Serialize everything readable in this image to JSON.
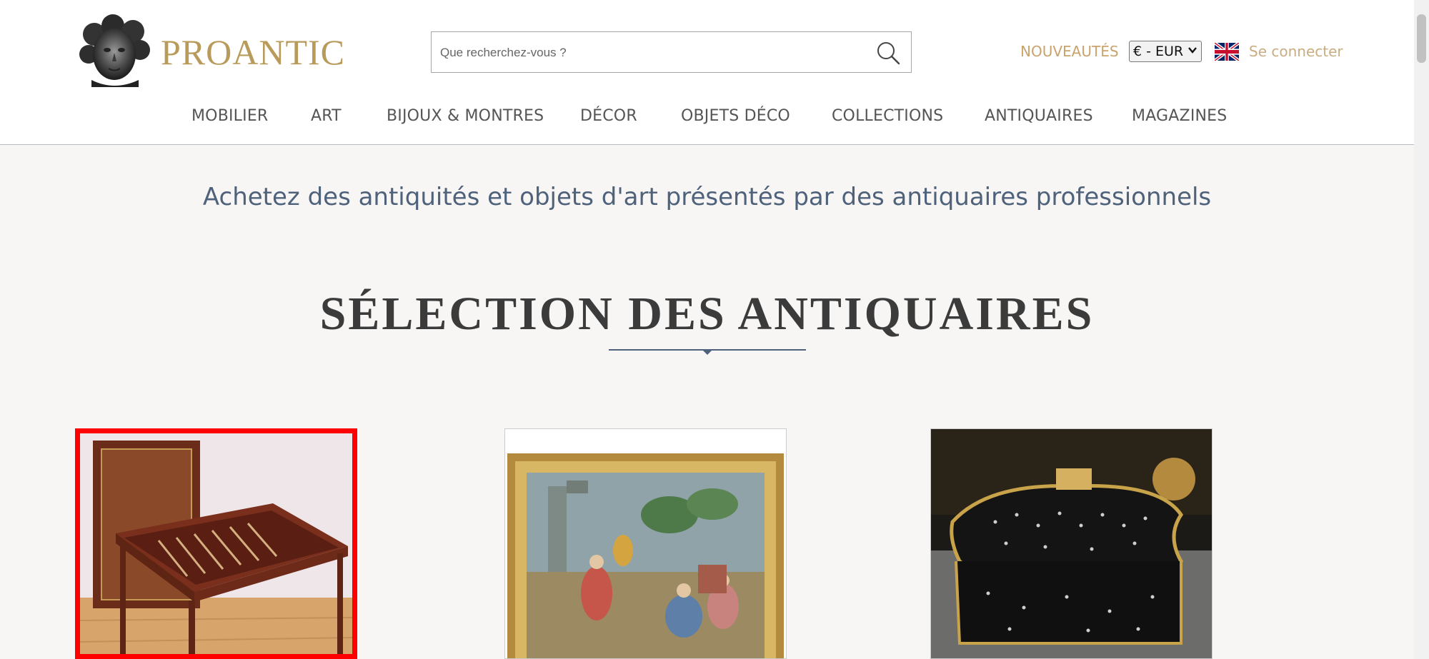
{
  "header": {
    "logo_text": "PROANTIC",
    "search_placeholder": "Que recherchez-vous ?",
    "nouveautes": "NOUVEAUTÉS",
    "currency": "€ - EUR",
    "login": "Se connecter"
  },
  "nav": [
    "MOBILIER",
    "ART",
    "BIJOUX & MONTRES",
    "DÉCOR",
    "OBJETS DÉCO",
    "COLLECTIONS",
    "ANTIQUAIRES",
    "MAGAZINES"
  ],
  "main": {
    "tagline": "Achetez des antiquités et objets d'art présentés par des antiquaires professionnels",
    "section_title": "SÉLECTION DES ANTIQUAIRES"
  },
  "colors": {
    "brand_gold": "#b89a5b",
    "tagline_blue": "#4f627b",
    "selection_outline": "#ff0000"
  },
  "icons": [
    "logo-bust-icon",
    "search-icon",
    "uk-flag-icon",
    "chevron-down-icon"
  ]
}
